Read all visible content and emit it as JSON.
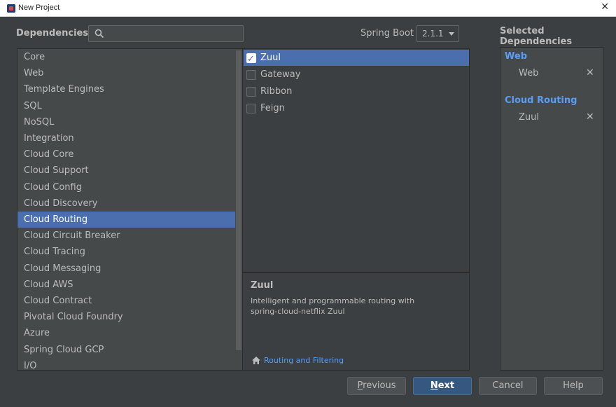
{
  "window": {
    "title": "New Project",
    "close_glyph": "✕"
  },
  "header": {
    "dependencies_label": "Dependencies",
    "search": {
      "value": "",
      "placeholder": ""
    },
    "spring_boot_label": "Spring Boot",
    "spring_boot_version": "2.1.1",
    "selected_title": "Selected Dependencies"
  },
  "categories": [
    {
      "label": "Core"
    },
    {
      "label": "Web"
    },
    {
      "label": "Template Engines"
    },
    {
      "label": "SQL"
    },
    {
      "label": "NoSQL"
    },
    {
      "label": "Integration"
    },
    {
      "label": "Cloud Core"
    },
    {
      "label": "Cloud Support"
    },
    {
      "label": "Cloud Config"
    },
    {
      "label": "Cloud Discovery"
    },
    {
      "label": "Cloud Routing"
    },
    {
      "label": "Cloud Circuit Breaker"
    },
    {
      "label": "Cloud Tracing"
    },
    {
      "label": "Cloud Messaging"
    },
    {
      "label": "Cloud AWS"
    },
    {
      "label": "Cloud Contract"
    },
    {
      "label": "Pivotal Cloud Foundry"
    },
    {
      "label": "Azure"
    },
    {
      "label": "Spring Cloud GCP"
    },
    {
      "label": "I/O"
    }
  ],
  "selected_category": "Cloud Routing",
  "dependencies": [
    {
      "label": "Zuul",
      "checked": true
    },
    {
      "label": "Gateway",
      "checked": false
    },
    {
      "label": "Ribbon",
      "checked": false
    },
    {
      "label": "Feign",
      "checked": false
    }
  ],
  "description": {
    "title": "Zuul",
    "line1": "Intelligent and programmable routing with",
    "line2": "spring-cloud-netflix Zuul",
    "link_label": "Routing and Filtering"
  },
  "selected_dependencies": [
    {
      "group": "Web",
      "items": [
        {
          "label": "Web"
        }
      ]
    },
    {
      "group": "Cloud Routing",
      "items": [
        {
          "label": "Zuul"
        }
      ]
    }
  ],
  "remove_glyph": "✕",
  "buttons": {
    "previous_underline": "P",
    "previous_rest": "revious",
    "next_underline": "N",
    "next_rest": "ext",
    "cancel": "Cancel",
    "help": "Help"
  },
  "colors": {
    "selection": "#4b6eaf",
    "link": "#589df6",
    "background": "#3c3f41"
  }
}
